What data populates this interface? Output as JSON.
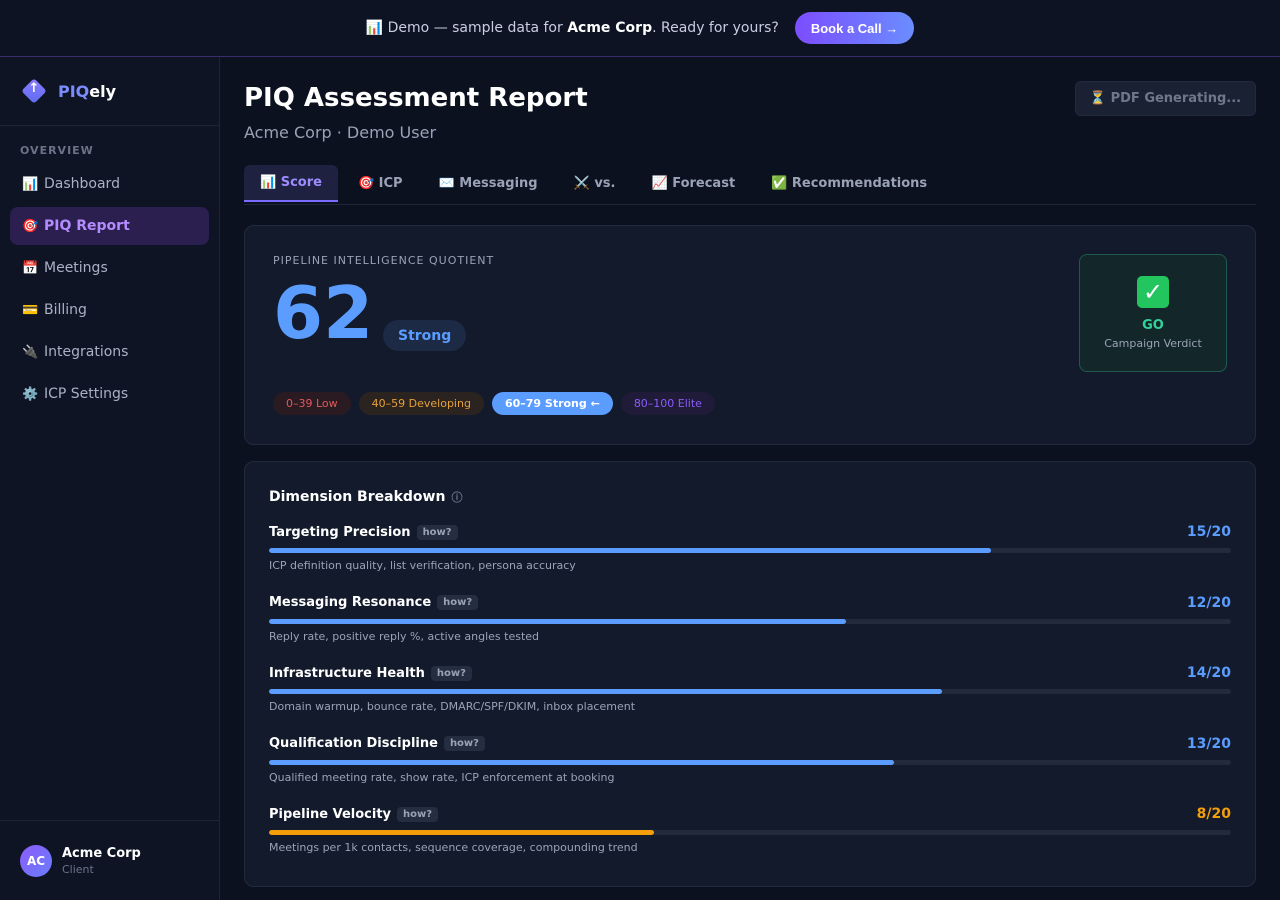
{
  "banner": {
    "icon": "chart-icon",
    "icon_glyph": "📊",
    "text_before": "Demo — sample data for ",
    "company": "Acme Corp",
    "text_after": ". Ready for yours?",
    "cta_label": "Book a Call →"
  },
  "sidebar": {
    "brand_piq": "PIQ",
    "brand_ely": "ely",
    "section_label": "OVERVIEW",
    "items": [
      {
        "icon_glyph": "📊",
        "label": "Dashboard",
        "active": false
      },
      {
        "icon_glyph": "🎯",
        "label": "PIQ Report",
        "active": true
      },
      {
        "icon_glyph": "📅",
        "label": "Meetings",
        "active": false
      },
      {
        "icon_glyph": "💳",
        "label": "Billing",
        "active": false
      },
      {
        "icon_glyph": "🔌",
        "label": "Integrations",
        "active": false
      },
      {
        "icon_glyph": "⚙️",
        "label": "ICP Settings",
        "active": false
      }
    ],
    "footer": {
      "initials": "AC",
      "name": "Acme Corp",
      "role": "Client"
    }
  },
  "header": {
    "title": "PIQ Assessment Report",
    "subtitle": "Acme Corp · Demo User",
    "pdf_label": "⏳ PDF Generating..."
  },
  "tabs": [
    {
      "label": "📊 Score",
      "active": true
    },
    {
      "label": "🎯 ICP",
      "active": false
    },
    {
      "label": "✉️ Messaging",
      "active": false
    },
    {
      "label": "⚔️ vs.",
      "active": false
    },
    {
      "label": "📈 Forecast",
      "active": false
    },
    {
      "label": "✅ Recommendations",
      "active": false
    }
  ],
  "score": {
    "label": "PIPELINE INTELLIGENCE QUOTIENT",
    "value": "62",
    "rating": "Strong",
    "ranges": [
      {
        "label": "0–39 Low",
        "kind": "low"
      },
      {
        "label": "40–59 Developing",
        "kind": "dev"
      },
      {
        "label": "60–79 Strong ←",
        "kind": "strong"
      },
      {
        "label": "80–100 Elite",
        "kind": "elite"
      }
    ],
    "verdict_icon": "✓",
    "verdict": "GO",
    "verdict_sub": "Campaign Verdict"
  },
  "dimensions": {
    "title": "Dimension Breakdown",
    "info_glyph": "ⓘ",
    "how_label": "how?",
    "items": [
      {
        "name": "Targeting Precision",
        "score": 15,
        "max": 20,
        "display": "15/20",
        "desc": "ICP definition quality, list verification, persona accuracy",
        "status": "ok"
      },
      {
        "name": "Messaging Resonance",
        "score": 12,
        "max": 20,
        "display": "12/20",
        "desc": "Reply rate, positive reply %, active angles tested",
        "status": "ok"
      },
      {
        "name": "Infrastructure Health",
        "score": 14,
        "max": 20,
        "display": "14/20",
        "desc": "Domain warmup, bounce rate, DMARC/SPF/DKIM, inbox placement",
        "status": "ok"
      },
      {
        "name": "Qualification Discipline",
        "score": 13,
        "max": 20,
        "display": "13/20",
        "desc": "Qualified meeting rate, show rate, ICP enforcement at booking",
        "status": "ok"
      },
      {
        "name": "Pipeline Velocity",
        "score": 8,
        "max": 20,
        "display": "8/20",
        "desc": "Meetings per 1k contacts, sequence coverage, compounding trend",
        "status": "warn"
      }
    ]
  },
  "colors": {
    "accent": "#5b9dff",
    "brand": "#7c6bff",
    "warn": "#f59e0b",
    "go": "#34d399"
  }
}
